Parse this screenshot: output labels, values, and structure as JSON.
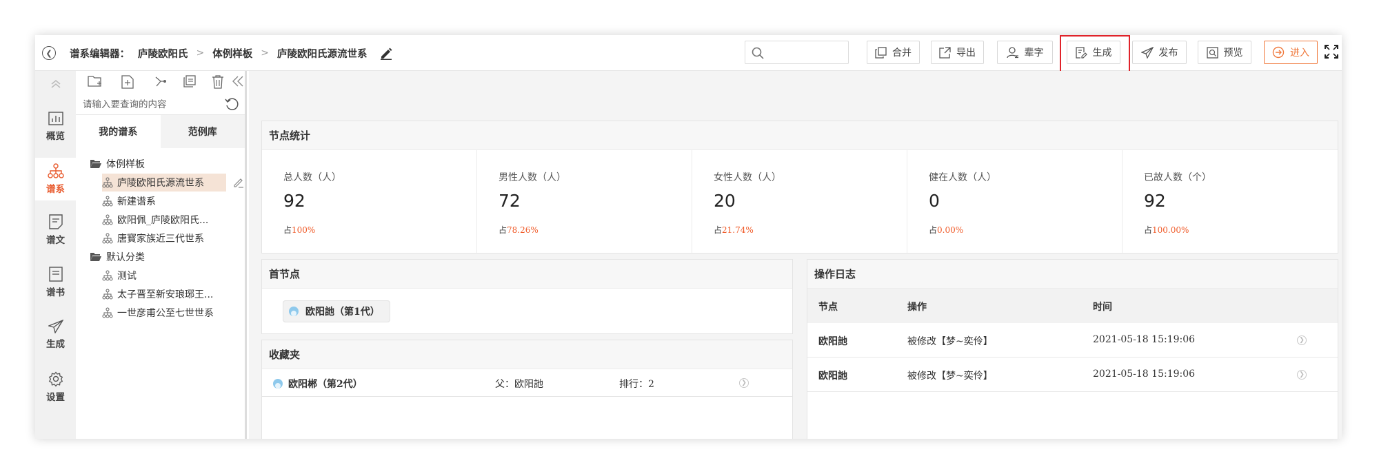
{
  "header": {
    "editor_label": "谱系编辑器：",
    "breadcrumb": [
      "庐陵欧阳氏",
      "体例样板",
      "庐陵欧阳氏源流世系"
    ],
    "search_placeholder": "",
    "buttons": {
      "merge": "合并",
      "export": "导出",
      "generation_char": "辈字",
      "generate": "生成",
      "publish": "发布",
      "preview": "预览",
      "enter": "进入"
    },
    "accent_color": "#f07a3e",
    "highlight_color": "#e0232a"
  },
  "rail": {
    "items": [
      {
        "label": "概览",
        "icon": "chart-icon"
      },
      {
        "label": "谱系",
        "icon": "tree-icon",
        "active": true
      },
      {
        "label": "谱文",
        "icon": "document-icon"
      },
      {
        "label": "谱书",
        "icon": "book-icon"
      },
      {
        "label": "生成",
        "icon": "send-icon"
      },
      {
        "label": "设置",
        "icon": "gear-icon"
      }
    ]
  },
  "tree": {
    "search_placeholder": "请输入要查询的内容",
    "tabs": [
      "我的谱系",
      "范例库"
    ],
    "folders": [
      {
        "name": "体例样板",
        "items": [
          "庐陵欧阳氏源流世系",
          "新建谱系",
          "欧阳佩_庐陵欧阳氏...",
          "唐寳家族近三代世系"
        ]
      },
      {
        "name": "默认分类",
        "items": [
          "测试",
          "太子晋至新安琅琊王...",
          "一世彦甫公至七世世系"
        ]
      }
    ]
  },
  "stats": {
    "title": "节点统计",
    "items": [
      {
        "label": "总人数（人）",
        "value": "92",
        "pct_prefix": "占",
        "pct": "100%"
      },
      {
        "label": "男性人数（人）",
        "value": "72",
        "pct_prefix": "占",
        "pct": "78.26%"
      },
      {
        "label": "女性人数（人）",
        "value": "20",
        "pct_prefix": "占",
        "pct": "21.74%"
      },
      {
        "label": "健在人数（人）",
        "value": "0",
        "pct_prefix": "占",
        "pct": "0.00%"
      },
      {
        "label": "已故人数（个）",
        "value": "92",
        "pct_prefix": "占",
        "pct": "100.00%"
      }
    ]
  },
  "first_node": {
    "title": "首节点",
    "chip": "欧阳訑（第1代）"
  },
  "favorites": {
    "title": "收藏夹",
    "rows": [
      {
        "name": "欧阳郴（第2代）",
        "father": "父：欧阳訑",
        "rank": "排行：2"
      }
    ]
  },
  "log": {
    "title": "操作日志",
    "headers": [
      "节点",
      "操作",
      "时间"
    ],
    "rows": [
      {
        "node": "欧阳訑",
        "op": "被修改【梦~奕伶】",
        "time": "2021-05-18 15:19:06"
      },
      {
        "node": "欧阳訑",
        "op": "被修改【梦~奕伶】",
        "time": "2021-05-18 15:19:06"
      }
    ]
  }
}
